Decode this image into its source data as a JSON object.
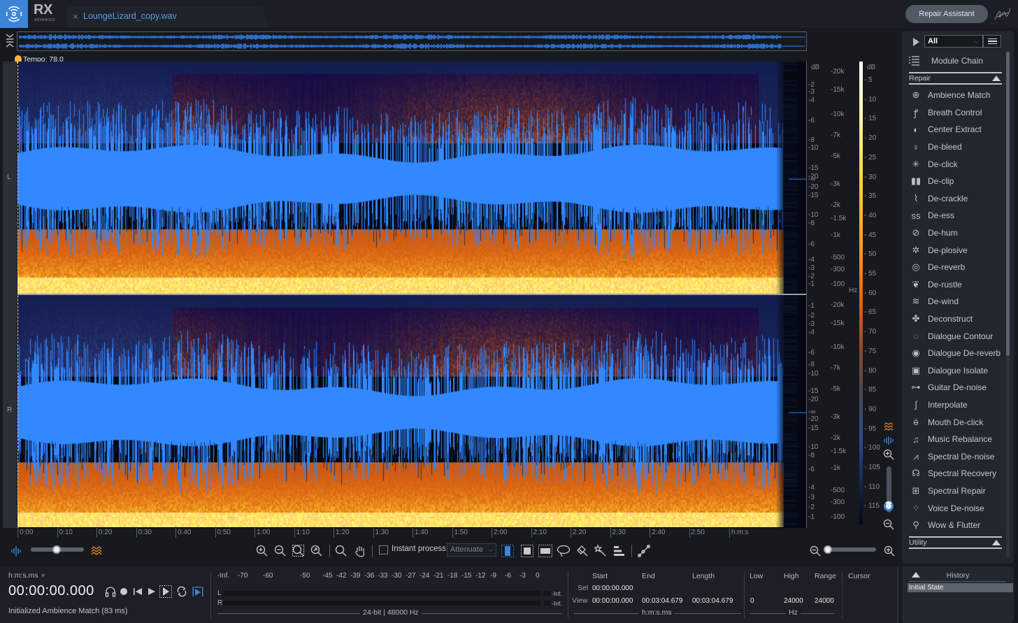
{
  "app": {
    "brand": "RX",
    "edition": "ADVANCED",
    "logo_icon": "izotope-rings-icon"
  },
  "tab": {
    "close_icon": "×",
    "title": "LoungeLizard_copy.wav"
  },
  "header": {
    "repair_assistant_label": "Repair Assistant",
    "signature_icon": "signature-icon"
  },
  "overview": {
    "collapse_icon": "collapse-icon",
    "channels": [
      "L",
      "R"
    ]
  },
  "tempo": {
    "label": "Tempo: 78.0"
  },
  "spectrogram": {
    "channels": [
      {
        "label": "L"
      },
      {
        "label": "R"
      }
    ],
    "colors": {
      "waveform": "#3388ff",
      "spectral_hot": "#ff9a2c",
      "spectral_peak": "#ffe27a",
      "background": "#050812"
    }
  },
  "axes": {
    "amp_unit": "dB",
    "amp_ticks_top": [
      "-2",
      "-3",
      "-4",
      "-6",
      "-8",
      "-10",
      "-15",
      "-20",
      "-∞",
      "-20",
      "-15",
      "-10",
      "-8",
      "-6",
      "-4",
      "-3",
      "-2",
      "-1"
    ],
    "amp_ticks_bottom": [
      "-1",
      "-2",
      "-3",
      "-4",
      "-6",
      "-8",
      "-10",
      "-15",
      "-20",
      "-∞",
      "-20",
      "-15",
      "-10",
      "-8",
      "-6",
      "-4",
      "-3",
      "-2",
      "-1"
    ],
    "freq_unit": "Hz",
    "freq_ticks": [
      "-20k",
      "-15k",
      "-10k",
      "-7k",
      "-5k",
      "-3k",
      "-2k",
      "-1.5k",
      "-1k",
      "-500",
      "-300",
      "-100"
    ],
    "colorbar_unit": "dB",
    "colorbar_ticks": [
      "5",
      "10",
      "15",
      "20",
      "25",
      "30",
      "35",
      "40",
      "45",
      "50",
      "55",
      "60",
      "65",
      "70",
      "75",
      "80",
      "85",
      "90",
      "95",
      "100",
      "105",
      "110",
      "115"
    ]
  },
  "time_ruler": {
    "ticks": [
      "0:00",
      "0:10",
      "0:20",
      "0:30",
      "0:40",
      "0:50",
      "1:00",
      "1:10",
      "1:20",
      "1:30",
      "1:40",
      "1:50",
      "2:00",
      "2:10",
      "2:20",
      "2:30",
      "2:40",
      "2:50"
    ],
    "unit": "h:m:s"
  },
  "toolbar": {
    "waveform_spectrogram_blend": 0.55,
    "zoom_in": "zoom-in-icon",
    "zoom_out": "zoom-out-icon",
    "zoom_selection": "zoom-selection-icon",
    "zoom_fit": "zoom-fit-icon",
    "zoom_tool": "magnifier-icon",
    "hand_tool": "hand-icon",
    "instant_process_label": "Instant process",
    "instant_process_checked": false,
    "attenuate_mode": "Attenuate",
    "horizontal_zoom": 0.05
  },
  "vertical_zoom": {
    "level": 0.1
  },
  "module_panel": {
    "filter_value": "All",
    "module_chain_label": "Module Chain",
    "sections": {
      "repair": "Repair",
      "utility": "Utility"
    },
    "modules": [
      {
        "label": "Ambience Match",
        "icon": "ambience-match-icon",
        "glyph": "⊕"
      },
      {
        "label": "Breath Control",
        "icon": "breath-control-icon",
        "glyph": "ꝭ"
      },
      {
        "label": "Center Extract",
        "icon": "center-extract-icon",
        "glyph": "◐"
      },
      {
        "label": "De-bleed",
        "icon": "microphone-icon",
        "glyph": "♀"
      },
      {
        "label": "De-click",
        "icon": "de-click-icon",
        "glyph": "✳"
      },
      {
        "label": "De-clip",
        "icon": "de-clip-icon",
        "glyph": "▮▮"
      },
      {
        "label": "De-crackle",
        "icon": "de-crackle-icon",
        "glyph": "⌇"
      },
      {
        "label": "De-ess",
        "icon": "de-ess-icon",
        "glyph": "ss"
      },
      {
        "label": "De-hum",
        "icon": "de-hum-icon",
        "glyph": "⊘"
      },
      {
        "label": "De-plosive",
        "icon": "de-plosive-icon",
        "glyph": "✲"
      },
      {
        "label": "De-reverb",
        "icon": "de-reverb-icon",
        "glyph": "◎"
      },
      {
        "label": "De-rustle",
        "icon": "leaf-icon",
        "glyph": "❦"
      },
      {
        "label": "De-wind",
        "icon": "wind-icon",
        "glyph": "≋"
      },
      {
        "label": "Deconstruct",
        "icon": "puzzle-icon",
        "glyph": "✤"
      },
      {
        "label": "Dialogue Contour",
        "icon": "dialogue-contour-icon",
        "glyph": "◌"
      },
      {
        "label": "Dialogue De-reverb",
        "icon": "dialogue-de-reverb-icon",
        "glyph": "◉"
      },
      {
        "label": "Dialogue Isolate",
        "icon": "dialogue-isolate-icon",
        "glyph": "▣"
      },
      {
        "label": "Guitar De-noise",
        "icon": "guitar-icon",
        "glyph": "⊶"
      },
      {
        "label": "Interpolate",
        "icon": "interpolate-icon",
        "glyph": "∫"
      },
      {
        "label": "Mouth De-click",
        "icon": "mouth-icon",
        "glyph": "ӫ"
      },
      {
        "label": "Music Rebalance",
        "icon": "music-rebalance-icon",
        "glyph": "♫"
      },
      {
        "label": "Spectral De-noise",
        "icon": "spectral-de-noise-icon",
        "glyph": "⩘"
      },
      {
        "label": "Spectral Recovery",
        "icon": "spectral-recovery-icon",
        "glyph": "☊"
      },
      {
        "label": "Spectral Repair",
        "icon": "spectral-repair-icon",
        "glyph": "⊞"
      },
      {
        "label": "Voice De-noise",
        "icon": "voice-de-noise-icon",
        "glyph": "⁘"
      },
      {
        "label": "Wow & Flutter",
        "icon": "wow-flutter-icon",
        "glyph": "⚲"
      }
    ]
  },
  "history": {
    "title": "History",
    "items": [
      "Initial State"
    ]
  },
  "transport": {
    "format_label": "h:m:s.ms",
    "timecode": "00:00:00.000",
    "status": "Initialized Ambience Match (83 ms)"
  },
  "meter": {
    "scale": [
      "-Inf.",
      "-70",
      "-60",
      "-50",
      "-45",
      "-42",
      "-39",
      "-36",
      "-33",
      "-30",
      "-27",
      "-24",
      "-21",
      "-18",
      "-15",
      "-12",
      "-9",
      "-6",
      "-3",
      "0"
    ],
    "channels": [
      {
        "label": "L",
        "peak": "-Inf.",
        "level": 0
      },
      {
        "label": "R",
        "peak": "-Inf.",
        "level": 0
      }
    ],
    "format": "24-bit | 48000 Hz"
  },
  "selection_info": {
    "headers": {
      "start": "Start",
      "end": "End",
      "length": "Length",
      "low": "Low",
      "high": "High",
      "range": "Range",
      "cursor": "Cursor"
    },
    "sel": {
      "label": "Sel",
      "start": "00:00:00.000"
    },
    "view": {
      "label": "View",
      "start": "00:00:00.000",
      "end": "00:03:04.679",
      "length": "00:03:04.679",
      "low": "0",
      "high": "24000",
      "range": "24000"
    },
    "time_unit": "h:m:s.ms",
    "freq_unit": "Hz"
  }
}
